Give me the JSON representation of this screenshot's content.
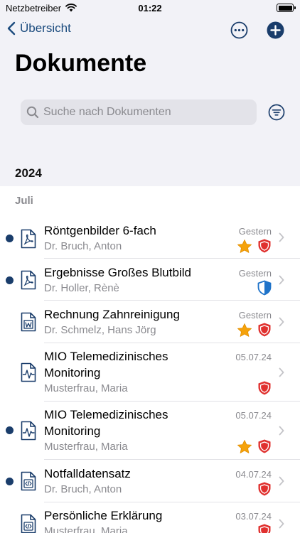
{
  "status_bar": {
    "carrier": "Netzbetreiber",
    "time": "01:22"
  },
  "nav": {
    "back_label": "Übersicht",
    "more_icon": "ellipsis-circle-icon",
    "add_icon": "plus-circle-icon"
  },
  "page_title": "Dokumente",
  "search": {
    "placeholder": "Suche nach Dokumenten"
  },
  "year": "2024",
  "month": "Juli",
  "colors": {
    "accent": "#1a3d6b",
    "star": "#f5a20b",
    "shield_red": "#e0312f",
    "shield_blue": "#1f73c9"
  },
  "documents": [
    {
      "title": "Röntgenbilder 6-fach",
      "author": "Dr. Bruch, Anton",
      "date": "Gestern",
      "unread": true,
      "icon": "pdf-file-icon",
      "starred": true,
      "shield": "red"
    },
    {
      "title": "Ergebnisse Großes Blutbild",
      "author": "Dr. Holler, Rènè",
      "date": "Gestern",
      "unread": true,
      "icon": "pdf-file-icon",
      "starred": false,
      "shield": "blue"
    },
    {
      "title": "Rechnung Zahnreinigung",
      "author": "Dr. Schmelz, Hans Jörg",
      "date": "Gestern",
      "unread": false,
      "icon": "word-file-icon",
      "starred": true,
      "shield": "red"
    },
    {
      "title": "MIO Telemedizinisches Monitoring",
      "author": "Musterfrau, Maria",
      "date": "05.07.24",
      "unread": false,
      "icon": "waveform-file-icon",
      "starred": false,
      "shield": "red"
    },
    {
      "title": "MIO Telemedizinisches Monitoring",
      "author": "Musterfrau, Maria",
      "date": "05.07.24",
      "unread": true,
      "icon": "waveform-file-icon",
      "starred": true,
      "shield": "red"
    },
    {
      "title": "Notfalldatensatz",
      "author": "Dr. Bruch, Anton",
      "date": "04.07.24",
      "unread": true,
      "icon": "code-file-icon",
      "starred": false,
      "shield": "red"
    },
    {
      "title": "Persönliche Erklärung",
      "author": "Musterfrau, Maria",
      "date": "03.07.24",
      "unread": false,
      "icon": "code-file-icon",
      "starred": false,
      "shield": "red"
    }
  ]
}
